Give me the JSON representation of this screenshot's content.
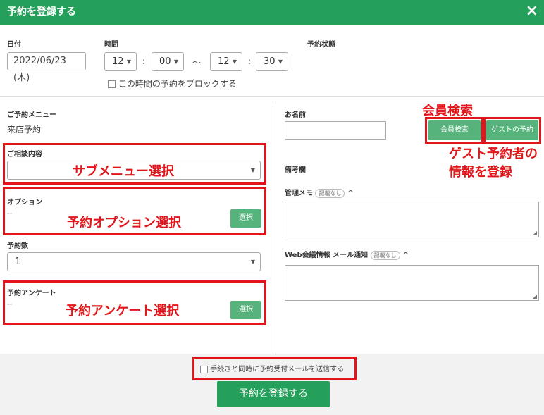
{
  "header": {
    "title": "予約を登録する",
    "close_icon": "×"
  },
  "date": {
    "label": "日付",
    "value": "2022/06/23 (木)"
  },
  "time": {
    "label": "時間",
    "start_hour": "12",
    "start_minute": "00",
    "tilde": "～",
    "end_hour": "12",
    "end_minute": "30",
    "colon": ":"
  },
  "status": {
    "label": "予約状態"
  },
  "block": {
    "label": "この時間の予約をブロックする"
  },
  "left": {
    "menu_label": "ご予約メニュー",
    "menu_value": "来店予約",
    "consult_label": "ご相談内容",
    "option_label": "オプション",
    "option_value": "--",
    "option_button": "選択",
    "count_label": "予約数",
    "count_value": "1",
    "survey_label": "予約アンケート",
    "survey_value": "--",
    "survey_button": "選択"
  },
  "right": {
    "name_label": "お名前",
    "member_search_button": "会員検索",
    "guest_button": "ゲストの予約",
    "remarks_label": "備考欄",
    "memo_label": "管理メモ",
    "memo_tag": "記載なし",
    "web_label": "Web会議情報 メール通知",
    "web_tag": "記載なし"
  },
  "footer": {
    "send_mail_label": "手続きと同時に予約受付メールを送信する",
    "submit": "予約を登録する"
  },
  "annotations": {
    "submenu": "サブメニュー選択",
    "option": "予約オプション選択",
    "survey": "予約アンケート選択",
    "member_search": "会員検索",
    "guest_line1": "ゲスト予約者の",
    "guest_line2": "情報を登録"
  },
  "colors": {
    "header": "#25a05a",
    "button": "#57b37c",
    "annotation": "#e0161b"
  }
}
